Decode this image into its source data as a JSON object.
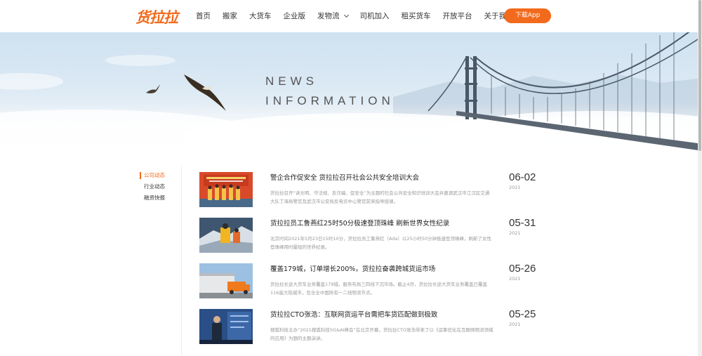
{
  "header": {
    "logo": "货拉拉",
    "nav": [
      {
        "label": "首页",
        "dropdown": false
      },
      {
        "label": "搬家",
        "dropdown": false
      },
      {
        "label": "大货车",
        "dropdown": false
      },
      {
        "label": "企业版",
        "dropdown": false
      },
      {
        "label": "发物流",
        "dropdown": true
      },
      {
        "label": "司机加入",
        "dropdown": false
      },
      {
        "label": "租买货车",
        "dropdown": false
      },
      {
        "label": "开放平台",
        "dropdown": false
      },
      {
        "label": "关于我们",
        "dropdown": true
      }
    ],
    "download_label": "下载App",
    "accent_color": "#f26a1b"
  },
  "banner": {
    "title_line1": "NEWS",
    "title_line2": "INFORMATION"
  },
  "sidebar": {
    "items": [
      {
        "label": "公司动态",
        "active": true
      },
      {
        "label": "行业动态",
        "active": false
      },
      {
        "label": "融资快报",
        "active": false
      }
    ]
  },
  "news": [
    {
      "title": "警企合作促安全 货拉拉召开社会公共安全培训大会",
      "excerpt": "货拉拉召开“讲文明、守法规、反诈骗、促安全”为主题的社会公共安全知识培训大会并邀请武汉市江汉区交通大队丁海局警官及武汉市公安局反电诈中心警官前来指导授课。",
      "date": "06-02",
      "year": "2021",
      "thumb": "group-banner-photo"
    },
    {
      "title": "货拉拉员工鲁燕红25时50分极速登顶珠峰 刷新世界女性纪录",
      "excerpt": "北京时间2021年5月23日15时10分，货拉拉员工鲁燕红（Ada）以25小时50分钟极速登顶珠峰，刷新了女性登珠峰用时最短的世界纪录。",
      "date": "05-31",
      "year": "2021",
      "thumb": "everest-climber-photo"
    },
    {
      "title": "覆盖179城，订单增长200%，货拉拉奋袭跨城货运市场",
      "excerpt": "货拉拉长途大货车业务覆盖179城，服务布局三四线下沉市场。截止4月，货拉拉长途大货车业务覆盖已覆盖116座大陆城市，包含全中国所有一二线物流节点。",
      "date": "05-26",
      "year": "2021",
      "thumb": "truck-warehouse-photo"
    },
    {
      "title": "货拉拉CTO张浩：互联网货运平台需把车货匹配做到极致",
      "excerpt": "搜狐科技主办“2021搜狐科技5G&AI峰会”在北京开幕，货拉拉CTO张浩带来了以《运筹优化在互联网物流领域的应用》为题的主题演讲。",
      "date": "05-25",
      "year": "2021",
      "thumb": "speaker-stage-photo"
    }
  ]
}
